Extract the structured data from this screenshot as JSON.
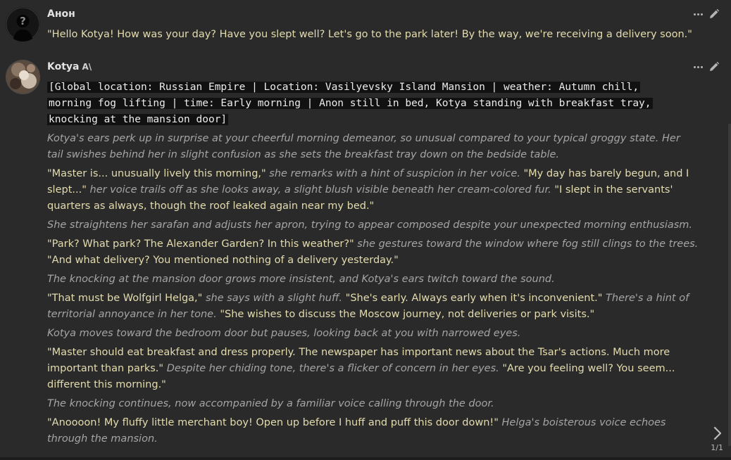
{
  "messages": [
    {
      "name": "Анон",
      "text": "\"Hello Kotya! How was your day? Have you slept well? Let's go to the park later! By the way, we're receiving a delivery soon.\""
    },
    {
      "name": "Kotya",
      "name_badge": "A\\",
      "code_lines": [
        "[Global location: Russian Empire | Location: Vasilyevsky Island Mansion | weather: Autumn chill,",
        "morning fog lifting | time: Early morning | Anon still in bed, Kotya standing with breakfast tray,",
        "knocking at the mansion door]"
      ],
      "p1": {
        "e1": "Kotya's ears perk up in surprise at your cheerful morning demeanor, so unusual compared to your typical groggy state. Her tail swishes behind her in slight confusion as she sets the breakfast tray down on the bedside table."
      },
      "p2": {
        "q1": "\"Master is... unusually lively this morning,\"",
        "e1": " she remarks with a hint of suspicion in her voice. ",
        "q2": "\"My day has barely begun, and I slept...\"",
        "e2": " her voice trails off as she looks away, a slight blush visible beneath her cream-colored fur. ",
        "q3": "\"I slept in the servants' quarters as always, though the roof leaked again near my bed.\""
      },
      "p3": {
        "e1": "She straightens her sarafan and adjusts her apron, trying to appear composed despite your unexpected morning enthusiasm."
      },
      "p4": {
        "q1": "\"Park? What park? The Alexander Garden? In this weather?\"",
        "e1": " she gestures toward the window where fog still clings to the trees. ",
        "q2": "\"And what delivery? You mentioned nothing of a delivery yesterday.\""
      },
      "p5": {
        "e1": "The knocking at the mansion door grows more insistent, and Kotya's ears twitch toward the sound."
      },
      "p6": {
        "q1": "\"That must be Wolfgirl Helga,\"",
        "e1": " she says with a slight huff. ",
        "q2": "\"She's early. Always early when it's inconvenient.\"",
        "e2": " There's a hint of territorial annoyance in her tone. ",
        "q3": "\"She wishes to discuss the Moscow journey, not deliveries or park visits.\""
      },
      "p7": {
        "e1": "Kotya moves toward the bedroom door but pauses, looking back at you with narrowed eyes."
      },
      "p8": {
        "q1": "\"Master should eat breakfast and dress properly. The newspaper has important news about the Tsar's actions. Much more important than parks.\"",
        "e1": " Despite her chiding tone, there's a flicker of concern in her eyes. ",
        "q2": "\"Are you feeling well? You seem... different this morning.\""
      },
      "p9": {
        "e1": "The knocking continues, now accompanied by a familiar voice calling through the door."
      },
      "p10": {
        "q1": "\"Anoooon! My fluffy little merchant boy! Open up before I huff and puff this door down!\"",
        "e1": " Helga's boisterous voice echoes through the mansion."
      }
    }
  ],
  "swipe": {
    "counter": "1/1"
  },
  "icons": {
    "more": "ellipsis-icon",
    "edit": "pencil-icon",
    "swipe": "chevron-right-icon"
  },
  "colors": {
    "background": "#2a2a2a",
    "quote_text": "#e4dcae",
    "narration_text": "#a5a5a5",
    "name_text": "#e2e2e2",
    "code_background": "#111111"
  }
}
